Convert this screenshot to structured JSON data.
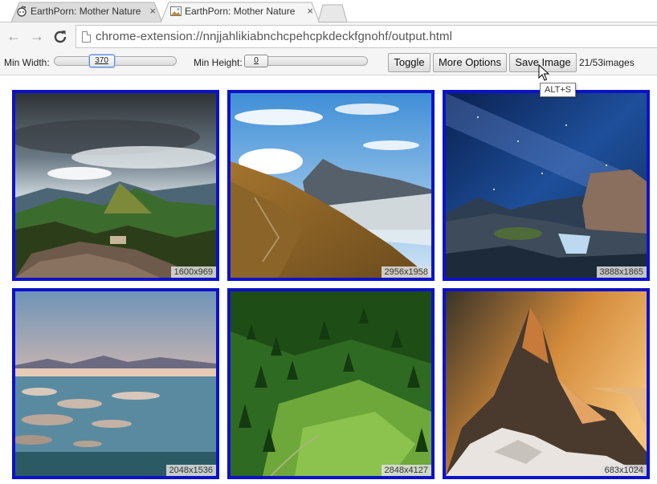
{
  "tabs": [
    {
      "title": "EarthPorn: Mother Nature",
      "active": false,
      "close": "×"
    },
    {
      "title": "EarthPorn: Mother Nature",
      "active": true,
      "close": "×"
    }
  ],
  "toolbar": {
    "back": "←",
    "forward": "→",
    "reload": "C",
    "url": "chrome-extension://nnjjahlikiabnchcpehcpkdeckfgnohf/output.html"
  },
  "controls": {
    "min_width_label": "Min Width:",
    "min_width_value": "370",
    "min_width_fraction": 0.36,
    "min_height_label": "Min Height:",
    "min_height_value": "0",
    "min_height_fraction": 0.0,
    "toggle_label": "Toggle",
    "more_options_label": "More Options",
    "save_image_label": "Save Image",
    "count_text": "21/53images",
    "tooltip": "ALT+S"
  },
  "images": [
    {
      "dims": "1600x969",
      "scene": "stormy-valley"
    },
    {
      "dims": "2956x1958",
      "scene": "grassy-ridge"
    },
    {
      "dims": "3888x1865",
      "scene": "milky-way-falls"
    },
    {
      "dims": "2048x1536",
      "scene": "lake-sunset"
    },
    {
      "dims": "2848x4127",
      "scene": "green-forest"
    },
    {
      "dims": "683x1024",
      "scene": "golden-peak"
    }
  ],
  "colors": {
    "card_border": "#0c12c8",
    "toolbar_bg": "#f5f5f5"
  }
}
